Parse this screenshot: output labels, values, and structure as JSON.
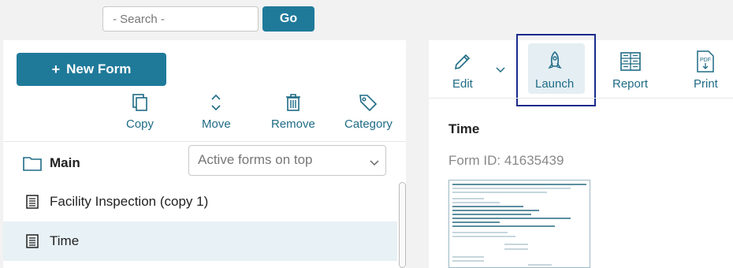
{
  "search": {
    "placeholder": "- Search -",
    "go_label": "Go"
  },
  "left": {
    "new_form_label": "New Form",
    "new_form_plus": "+",
    "actions": [
      {
        "label": "Copy",
        "icon": "copy-icon"
      },
      {
        "label": "Move",
        "icon": "move-icon"
      },
      {
        "label": "Remove",
        "icon": "trash-icon"
      },
      {
        "label": "Category",
        "icon": "tag-icon"
      }
    ],
    "folder": {
      "label": "Main",
      "icon": "folder-icon"
    },
    "sort": {
      "selected": "Active forms on top"
    },
    "forms": [
      {
        "name": "Facility Inspection (copy 1)",
        "selected": false
      },
      {
        "name": "Time",
        "selected": true
      }
    ]
  },
  "right": {
    "toolbar": [
      {
        "label": "Edit",
        "icon": "pencil-icon"
      },
      {
        "label": "Launch",
        "icon": "rocket-icon"
      },
      {
        "label": "Report",
        "icon": "report-icon"
      },
      {
        "label": "Print",
        "icon": "pdf-icon"
      }
    ],
    "title": "Time",
    "form_id": "Form ID: 41635439"
  },
  "colors": {
    "accent": "#1f7a9a",
    "icon": "#1f6b85",
    "selected_row": "#e8f1f5",
    "highlight_border": "#1a2a8c"
  }
}
